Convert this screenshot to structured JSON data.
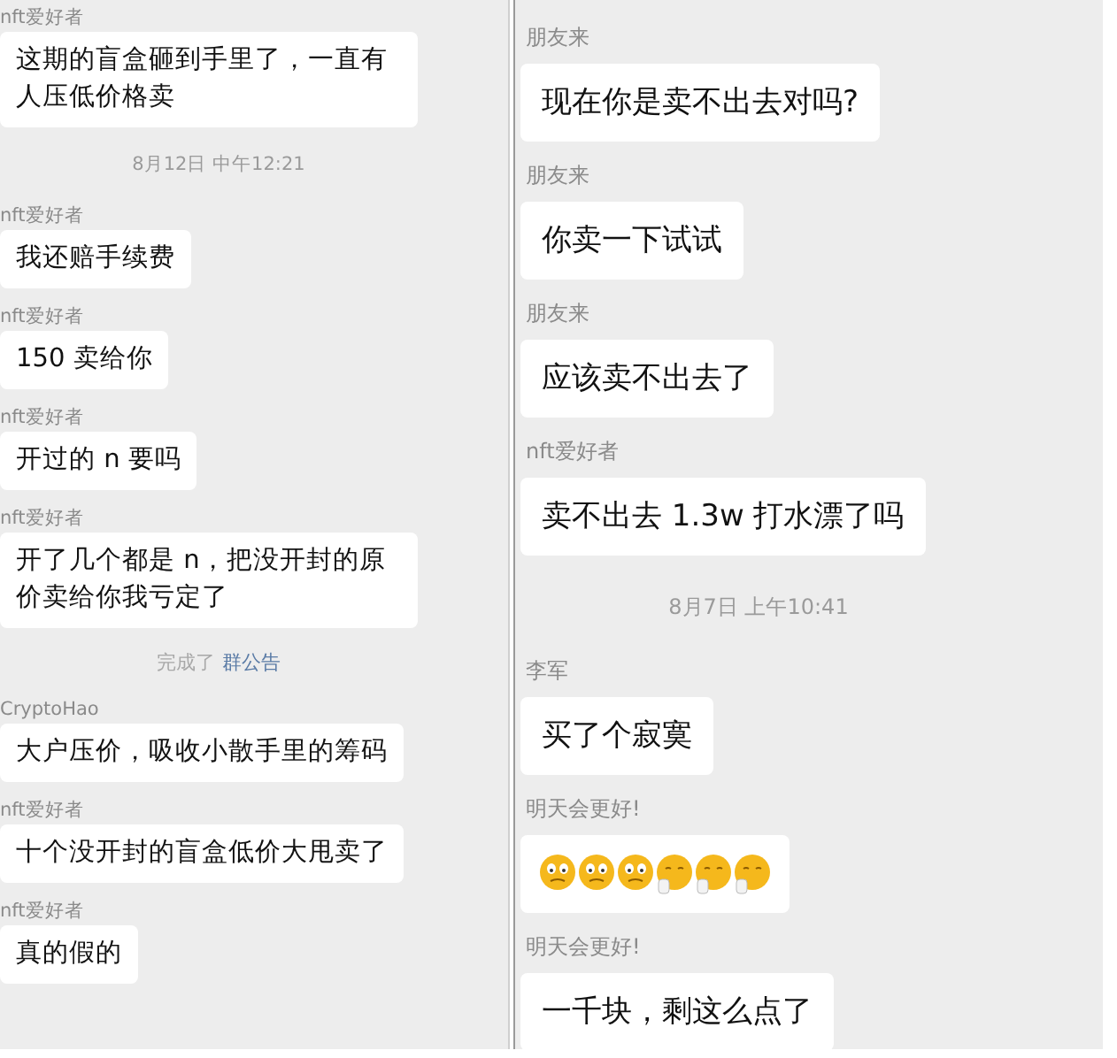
{
  "panels": [
    {
      "messages": [
        {
          "kind": "message",
          "sender": "nft爱好者",
          "text": "这期的盲盒砸到手里了，一直有人压低价格卖"
        },
        {
          "kind": "time",
          "text": "8月12日 中午12:21"
        },
        {
          "kind": "message",
          "sender": "nft爱好者",
          "text": "我还赔手续费"
        },
        {
          "kind": "message",
          "sender": "nft爱好者",
          "text": "150 卖给你"
        },
        {
          "kind": "message",
          "sender": "nft爱好者",
          "text": "开过的 n 要吗"
        },
        {
          "kind": "message",
          "sender": "nft爱好者",
          "text": "开了几个都是 n，把没开封的原价卖给你我亏定了"
        },
        {
          "kind": "notice",
          "text": "完成了",
          "link": "群公告"
        },
        {
          "kind": "message",
          "sender": "CryptoHao",
          "text": "大户压价，吸收小散手里的筹码"
        },
        {
          "kind": "message",
          "sender": "nft爱好者",
          "text": "十个没开封的盲盒低价大甩卖了"
        },
        {
          "kind": "message",
          "sender": "nft爱好者",
          "text": "真的假的"
        }
      ]
    },
    {
      "messages": [
        {
          "kind": "message",
          "sender": "朋友来",
          "text": "现在你是卖不出去对吗?"
        },
        {
          "kind": "message",
          "sender": "朋友来",
          "text": "你卖一下试试"
        },
        {
          "kind": "message",
          "sender": "朋友来",
          "text": "应该卖不出去了"
        },
        {
          "kind": "message",
          "sender": "nft爱好者",
          "text": "卖不出去 1.3w 打水漂了吗"
        },
        {
          "kind": "time",
          "text": "8月7日 上午10:41"
        },
        {
          "kind": "message",
          "sender": "李军",
          "text": "买了个寂寞"
        },
        {
          "kind": "emoji",
          "sender": "明天会更好!",
          "emojis": [
            {
              "kind": "worried"
            },
            {
              "kind": "worried"
            },
            {
              "kind": "worried"
            },
            {
              "kind": "covering"
            },
            {
              "kind": "covering"
            },
            {
              "kind": "covering"
            }
          ]
        },
        {
          "kind": "message",
          "sender": "明天会更好!",
          "text": "一千块，剩这么点了"
        }
      ]
    }
  ]
}
